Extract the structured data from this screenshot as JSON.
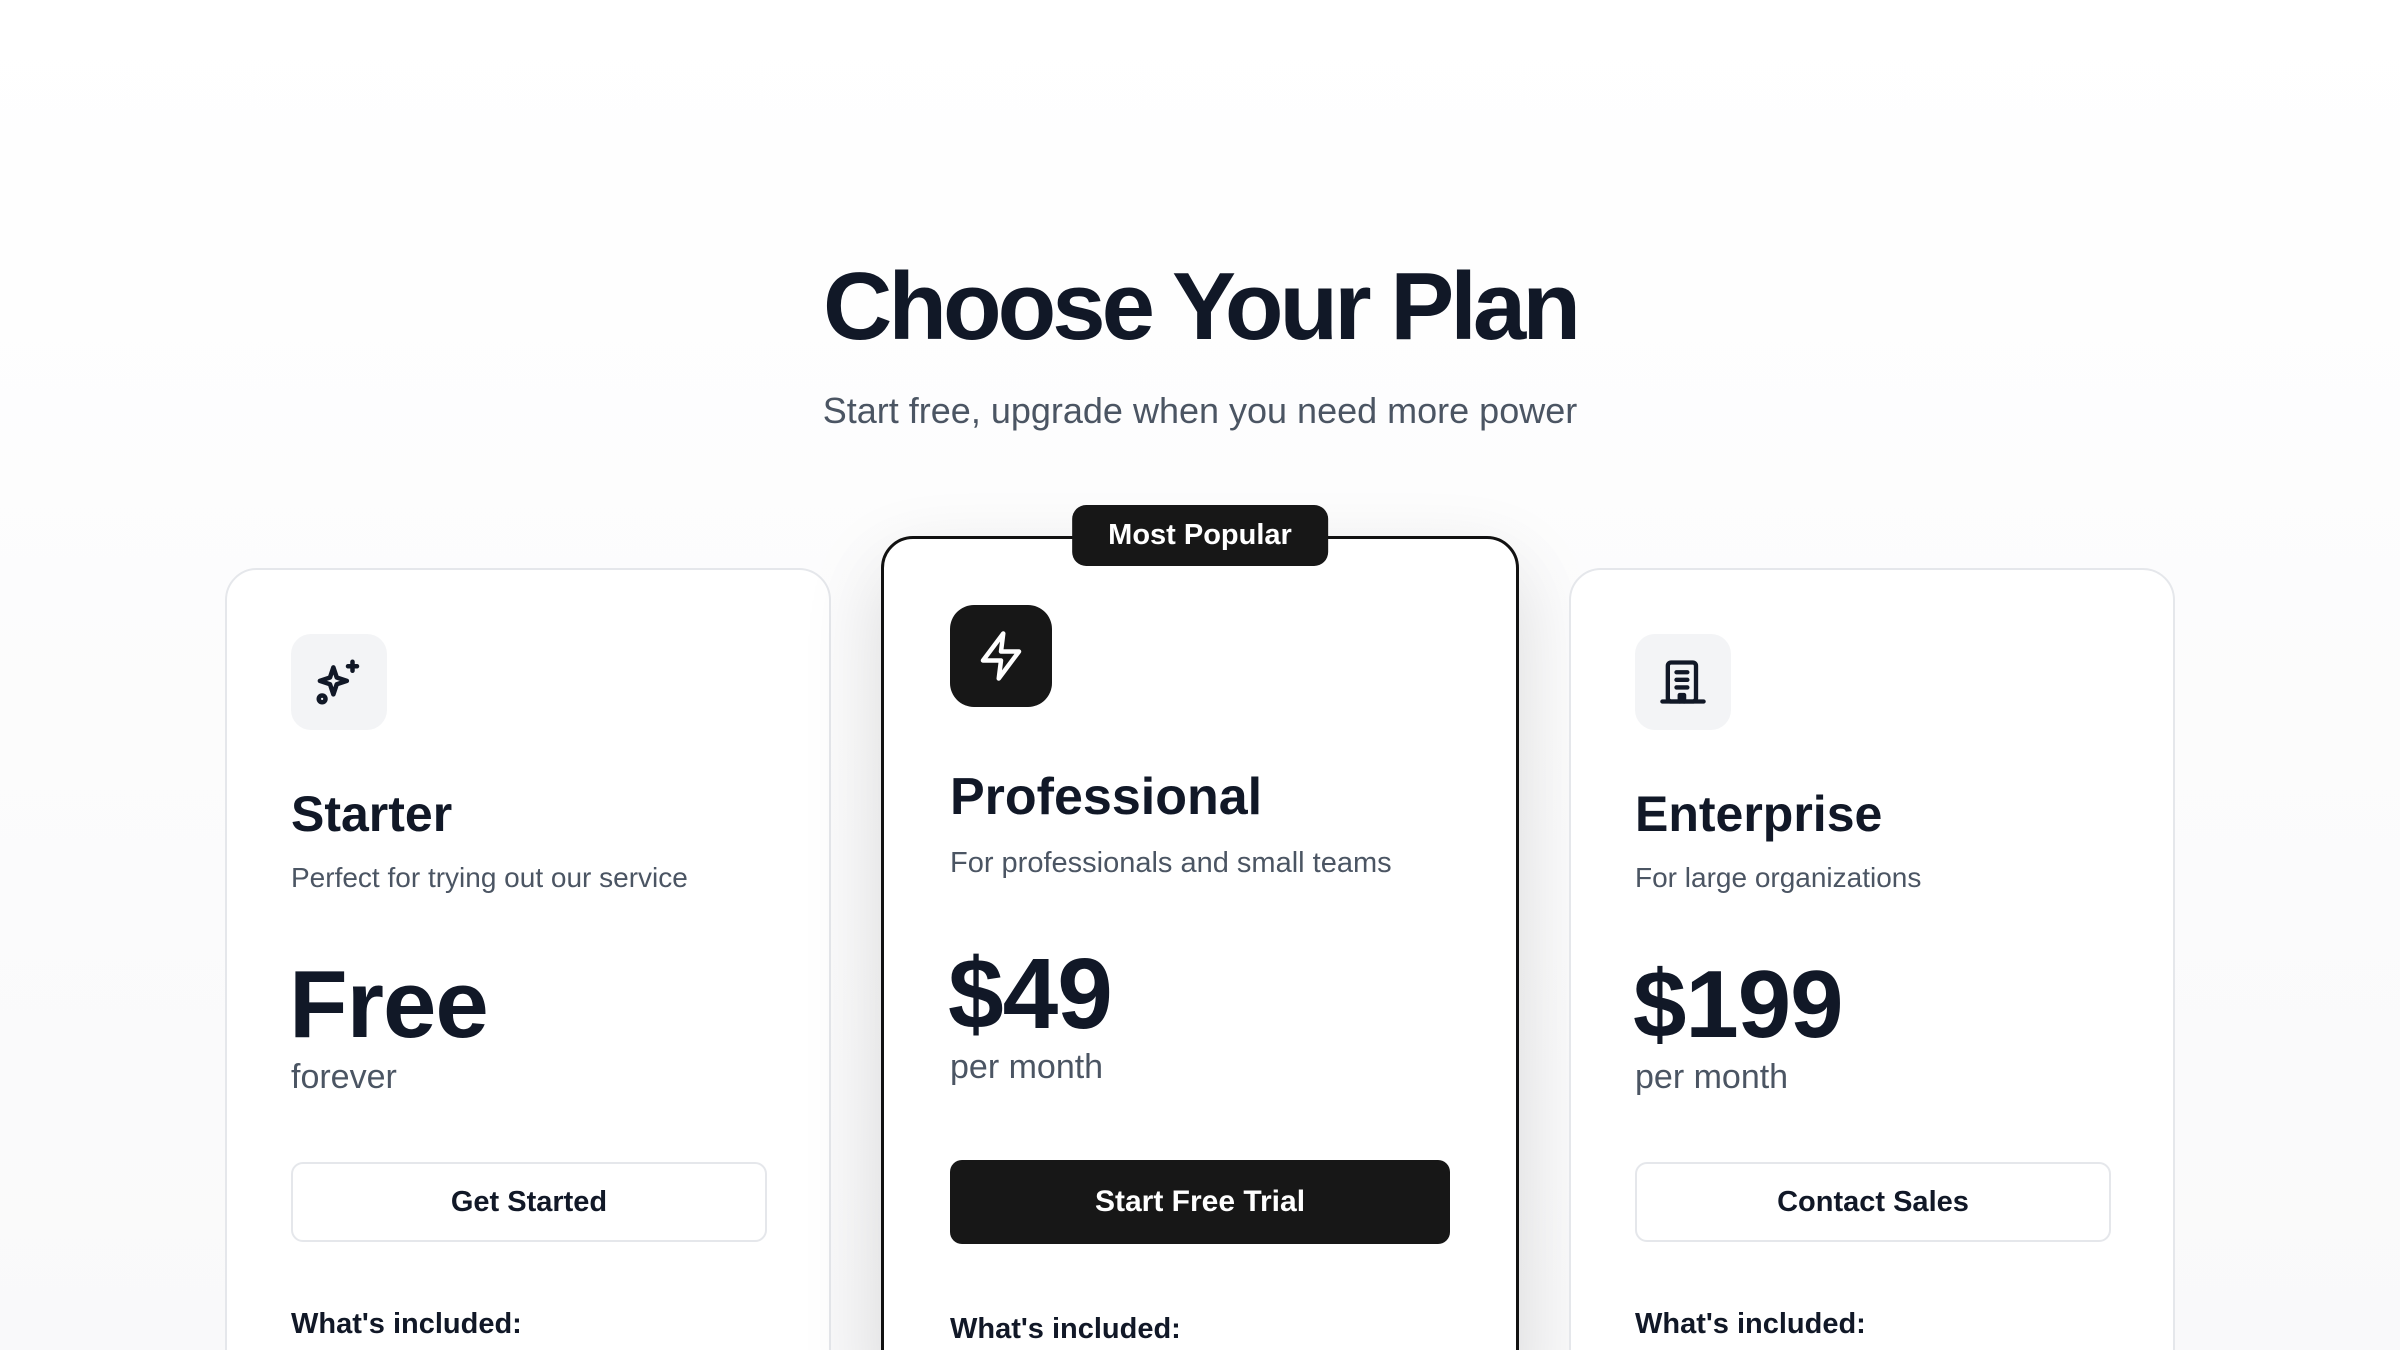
{
  "header": {
    "title": "Choose Your Plan",
    "subtitle": "Start free, upgrade when you need more power"
  },
  "plans": [
    {
      "name": "Starter",
      "description": "Perfect for trying out our service",
      "price": "Free",
      "period": "forever",
      "cta_label": "Get Started",
      "included_heading": "What's included:",
      "icon": "sparkles-icon"
    },
    {
      "name": "Professional",
      "description": "For professionals and small teams",
      "price": "$49",
      "period": "per month",
      "cta_label": "Start Free Trial",
      "included_heading": "What's included:",
      "icon": "lightning-bolt-icon",
      "badge": "Most Popular"
    },
    {
      "name": "Enterprise",
      "description": "For large organizations",
      "price": "$199",
      "period": "per month",
      "cta_label": "Contact Sales",
      "included_heading": "What's included:",
      "icon": "building-icon"
    }
  ],
  "colors": {
    "primary": "#171717",
    "text": "#111827",
    "muted": "#4b5563",
    "border": "#e5e7eb",
    "icon_bg": "#f3f4f6"
  }
}
